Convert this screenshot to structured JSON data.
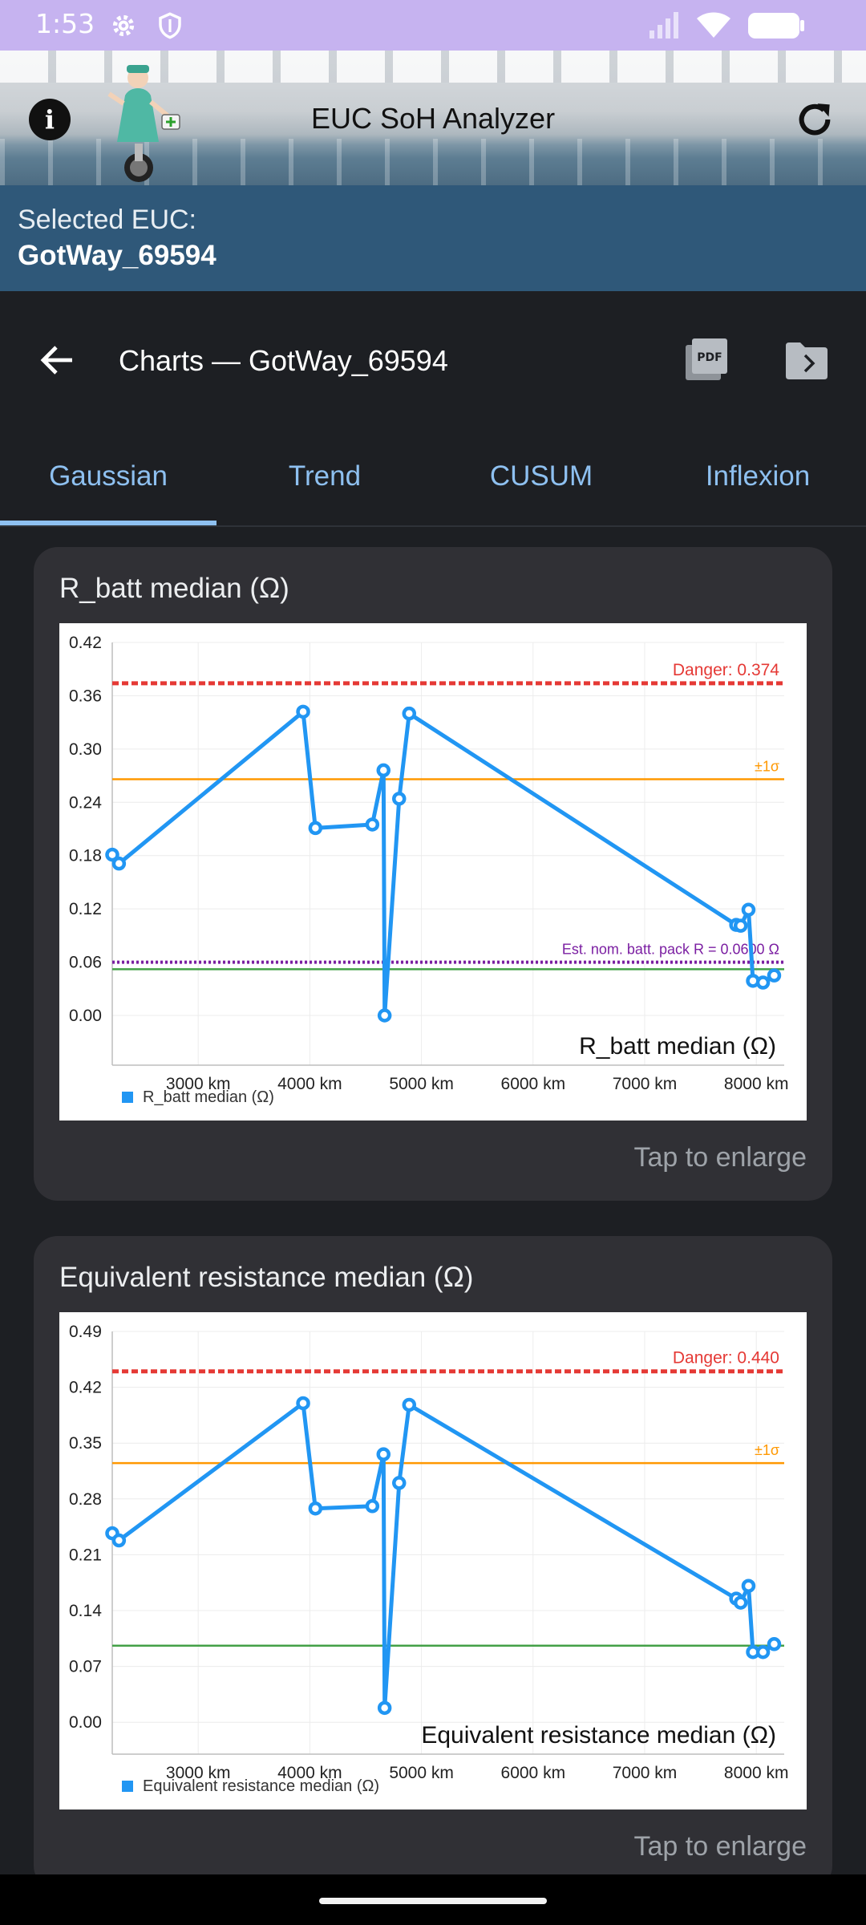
{
  "status_bar": {
    "time": "1:53",
    "icons": [
      "gear-icon",
      "shield-icon",
      "signal-icon",
      "wifi-icon",
      "battery-icon"
    ]
  },
  "header": {
    "title": "EUC SoH Analyzer",
    "icons": [
      "info-icon",
      "refresh-icon"
    ]
  },
  "selected": {
    "label": "Selected EUC:",
    "value": "GotWay_69594"
  },
  "toolbar": {
    "title": "Charts — GotWay_69594",
    "icons": [
      "back-arrow-icon",
      "pdf-icon",
      "folder-export-icon"
    ]
  },
  "tabs": [
    {
      "label": "Gaussian",
      "active": true
    },
    {
      "label": "Trend",
      "active": false
    },
    {
      "label": "CUSUM",
      "active": false
    },
    {
      "label": "Inflexion",
      "active": false
    }
  ],
  "cards": [
    {
      "title": "R_batt median (Ω)",
      "tap_label": "Tap to enlarge"
    },
    {
      "title": "Equivalent resistance median (Ω)",
      "tap_label": "Tap to enlarge"
    }
  ],
  "colors": {
    "series": "#2196f3",
    "danger": "#e53935",
    "sigma": "#ff9800",
    "nominal": "#7b1fa2",
    "green": "#43a047",
    "accent": "#8ec0f0"
  },
  "chart_data": [
    {
      "type": "line",
      "title": "R_batt median (Ω)",
      "xlabel": "",
      "ylabel": "",
      "inner_label": "R_batt median (Ω)",
      "x_unit": "km",
      "x_ticks": [
        3000,
        4000,
        5000,
        6000,
        7000,
        8000
      ],
      "x_tick_labels": [
        "3000 km",
        "4000 km",
        "5000 km",
        "6000 km",
        "7000 km",
        "8000 km"
      ],
      "y_ticks": [
        0.0,
        0.06,
        0.12,
        0.18,
        0.24,
        0.3,
        0.36,
        0.42
      ],
      "y_tick_labels": [
        "0.00",
        "0.06",
        "0.12",
        "0.18",
        "0.24",
        "0.30",
        "0.36",
        "0.42"
      ],
      "xlim": [
        2230,
        8250
      ],
      "ylim": [
        -0.056,
        0.42
      ],
      "legend": "bottom-left",
      "grid": true,
      "series": [
        {
          "name": "R_batt median (Ω)",
          "x": [
            2230,
            2290,
            3940,
            4050,
            4560,
            4660,
            4670,
            4800,
            4890,
            7820,
            7860,
            7930,
            7970,
            8060,
            8160
          ],
          "values": [
            0.181,
            0.171,
            0.342,
            0.211,
            0.215,
            0.276,
            0.0,
            0.244,
            0.34,
            0.102,
            0.101,
            0.119,
            0.039,
            0.037,
            0.045
          ]
        }
      ],
      "reference_lines": [
        {
          "label": "Danger: 0.374",
          "value": 0.374,
          "style": "dashed",
          "color": "#e53935"
        },
        {
          "label": "±1σ",
          "value": 0.266,
          "style": "solid",
          "color": "#ff9800"
        },
        {
          "label": "Est. nom. batt. pack R = 0.0600 Ω",
          "value": 0.06,
          "style": "dotted",
          "color": "#7b1fa2"
        },
        {
          "label": "",
          "value": 0.052,
          "style": "solid",
          "color": "#43a047"
        }
      ]
    },
    {
      "type": "line",
      "title": "Equivalent resistance median (Ω)",
      "xlabel": "",
      "ylabel": "",
      "inner_label": "Equivalent resistance median (Ω)",
      "x_unit": "km",
      "x_ticks": [
        3000,
        4000,
        5000,
        6000,
        7000,
        8000
      ],
      "x_tick_labels": [
        "3000 km",
        "4000 km",
        "5000 km",
        "6000 km",
        "7000 km",
        "8000 km"
      ],
      "y_ticks": [
        0.0,
        0.07,
        0.14,
        0.21,
        0.28,
        0.35,
        0.42,
        0.49
      ],
      "y_tick_labels": [
        "0.00",
        "0.07",
        "0.14",
        "0.21",
        "0.28",
        "0.35",
        "0.42",
        "0.49"
      ],
      "xlim": [
        2230,
        8250
      ],
      "ylim": [
        -0.04,
        0.49
      ],
      "legend": "bottom-left",
      "grid": true,
      "series": [
        {
          "name": "Equivalent resistance median (Ω)",
          "x": [
            2230,
            2290,
            3940,
            4050,
            4560,
            4660,
            4670,
            4800,
            4890,
            7820,
            7860,
            7930,
            7970,
            8060,
            8160
          ],
          "values": [
            0.237,
            0.228,
            0.4,
            0.268,
            0.271,
            0.336,
            0.018,
            0.3,
            0.398,
            0.155,
            0.15,
            0.171,
            0.088,
            0.088,
            0.098
          ]
        }
      ],
      "reference_lines": [
        {
          "label": "Danger: 0.440",
          "value": 0.44,
          "style": "dashed",
          "color": "#e53935"
        },
        {
          "label": "±1σ",
          "value": 0.325,
          "style": "solid",
          "color": "#ff9800"
        },
        {
          "label": "",
          "value": 0.096,
          "style": "solid",
          "color": "#43a047"
        }
      ]
    }
  ]
}
